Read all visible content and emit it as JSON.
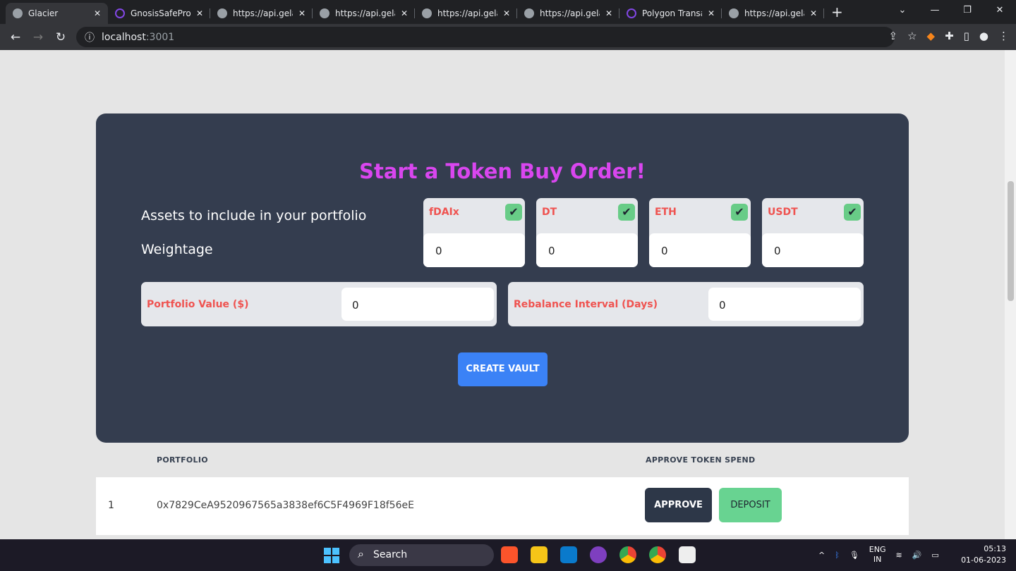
{
  "browser": {
    "tabs": [
      {
        "title": "Glacier",
        "icon": "globe-icon"
      },
      {
        "title": "GnosisSafeProxy",
        "icon": "polygon-icon"
      },
      {
        "title": "https://api.gelato",
        "icon": "globe-icon"
      },
      {
        "title": "https://api.gelato",
        "icon": "globe-icon"
      },
      {
        "title": "https://api.gelato",
        "icon": "globe-icon"
      },
      {
        "title": "https://api.gelato",
        "icon": "globe-icon"
      },
      {
        "title": "Polygon Transact",
        "icon": "polygon-icon"
      },
      {
        "title": "https://api.gelato",
        "icon": "globe-icon"
      }
    ],
    "url_host": "localhost",
    "url_port": ":3001"
  },
  "form": {
    "title": "Start a Token Buy Order!",
    "assets_label": "Assets to include in your portfolio",
    "weightage_label": "Weightage",
    "assets": [
      {
        "name": "fDAIx",
        "checked": true,
        "weight": "0"
      },
      {
        "name": "DT",
        "checked": true,
        "weight": "0"
      },
      {
        "name": "ETH",
        "checked": true,
        "weight": "0"
      },
      {
        "name": "USDT",
        "checked": true,
        "weight": "0"
      }
    ],
    "portfolio_value_label": "Portfolio Value ($)",
    "portfolio_value": "0",
    "rebalance_label": "Rebalance Interval (Days)",
    "rebalance_value": "0",
    "create_label": "CREATE VAULT"
  },
  "table": {
    "headers": [
      "PORTFOLIO",
      "APPROVE TOKEN SPEND"
    ],
    "rows": [
      {
        "index": "1",
        "address": "0x7829CeA9520967565a3838ef6C5F4969F18f56eE",
        "approve": "APPROVE",
        "deposit": "DEPOSIT"
      }
    ]
  },
  "taskbar": {
    "search": "Search",
    "lang1": "ENG",
    "lang2": "IN",
    "time": "05:13",
    "date": "01-06-2023"
  },
  "colors": {
    "card": "#343d4f",
    "title": "#d946ef",
    "accent": "#3b82f6",
    "check": "#68cc87"
  }
}
